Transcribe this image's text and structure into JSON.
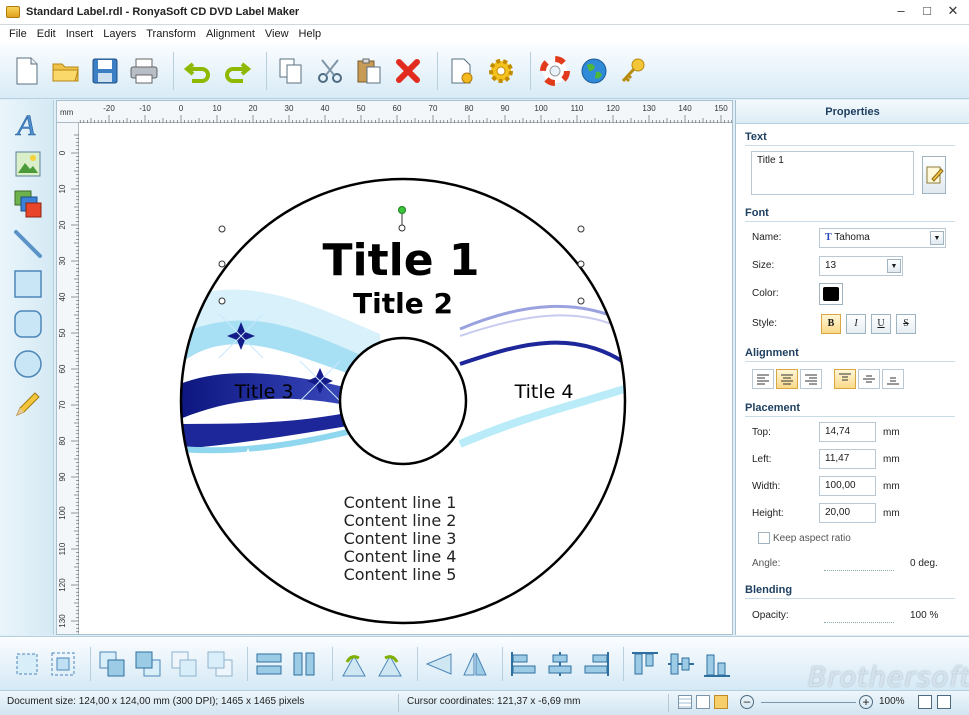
{
  "window": {
    "title": "Standard Label.rdl - RonyaSoft CD DVD Label Maker",
    "controls": [
      "minimize-icon",
      "maximize-icon",
      "close-icon"
    ]
  },
  "menu": [
    "File",
    "Edit",
    "Insert",
    "Layers",
    "Transform",
    "Alignment",
    "View",
    "Help"
  ],
  "toolbar": {
    "icons": [
      "new-document-icon",
      "open-folder-icon",
      "save-disk-icon",
      "print-icon",
      "undo-icon",
      "redo-icon",
      "copy-icon",
      "cut-scissors-icon",
      "paste-icon",
      "delete-x-icon",
      "page-settings-icon",
      "gear-icon",
      "help-lifebuoy-icon",
      "globe-icon",
      "key-icon"
    ]
  },
  "left_tools": [
    "text-tool-icon",
    "image-tool-icon",
    "layers-image-icon",
    "line-tool-icon",
    "rectangle-tool-icon",
    "rounded-rectangle-tool-icon",
    "ellipse-tool-icon",
    "pencil-tool-icon"
  ],
  "ruler": {
    "unit": "mm",
    "top_ticks": [
      "-20",
      "-10",
      "0",
      "10",
      "20",
      "30",
      "40",
      "50",
      "60",
      "70",
      "80",
      "90",
      "100",
      "110",
      "120",
      "130",
      "140",
      "150"
    ],
    "left_ticks": [
      "0",
      "10",
      "20",
      "30",
      "40",
      "50",
      "60",
      "70",
      "80",
      "90",
      "100",
      "110",
      "120",
      "130"
    ]
  },
  "label": {
    "title1": "Title 1",
    "title2": "Title 2",
    "title3": "Title 3",
    "title4": "Title 4",
    "content_lines": [
      "Content line 1",
      "Content line 2",
      "Content line 3",
      "Content line 4",
      "Content line 5"
    ]
  },
  "properties": {
    "header": "Properties",
    "text_section": "Text",
    "text_value": "Title 1",
    "font_section": "Font",
    "name_label": "Name:",
    "font_name": "Tahoma",
    "size_label": "Size:",
    "size_value": "13",
    "color_label": "Color:",
    "color_value": "#000000",
    "style_label": "Style:",
    "style_buttons": [
      "B",
      "I",
      "U",
      "S"
    ],
    "alignment_section": "Alignment",
    "placement_section": "Placement",
    "top_label": "Top:",
    "top_value": "14,74",
    "left_label": "Left:",
    "left_value": "11,47",
    "width_label": "Width:",
    "width_value": "100,00",
    "height_label": "Height:",
    "height_value": "20,00",
    "unit": "mm",
    "keep_aspect": "Keep aspect ratio",
    "angle_label": "Angle:",
    "angle_value": "0 deg.",
    "blending_section": "Blending",
    "opacity_label": "Opacity:",
    "opacity_value": "100 %"
  },
  "bottom_toolbar": {
    "icons": [
      "select-frame-icon",
      "select-group-icon",
      "bring-forward-icon",
      "send-backward-icon",
      "bring-front-icon",
      "send-back-icon",
      "distribute-horizontal-icon",
      "distribute-vertical-icon",
      "rotate-left-icon",
      "rotate-right-icon",
      "flip-horizontal-icon",
      "flip-vertical-icon",
      "align-left-icon",
      "align-center-icon",
      "align-right-icon",
      "align-top-icon",
      "align-middle-icon",
      "align-bottom-icon"
    ]
  },
  "status": {
    "document_size": "Document size: 124,00 x 124,00 mm (300 DPI); 1465 x 1465 pixels",
    "cursor": "Cursor coordinates: 121,37 x -6,69 mm",
    "zoom": "100%"
  },
  "watermark": "Brothersoft",
  "colors": {
    "accent": "#1f4060",
    "swoosh_dark": "#1a1f8c",
    "swoosh_light": "#8fd6ef"
  }
}
